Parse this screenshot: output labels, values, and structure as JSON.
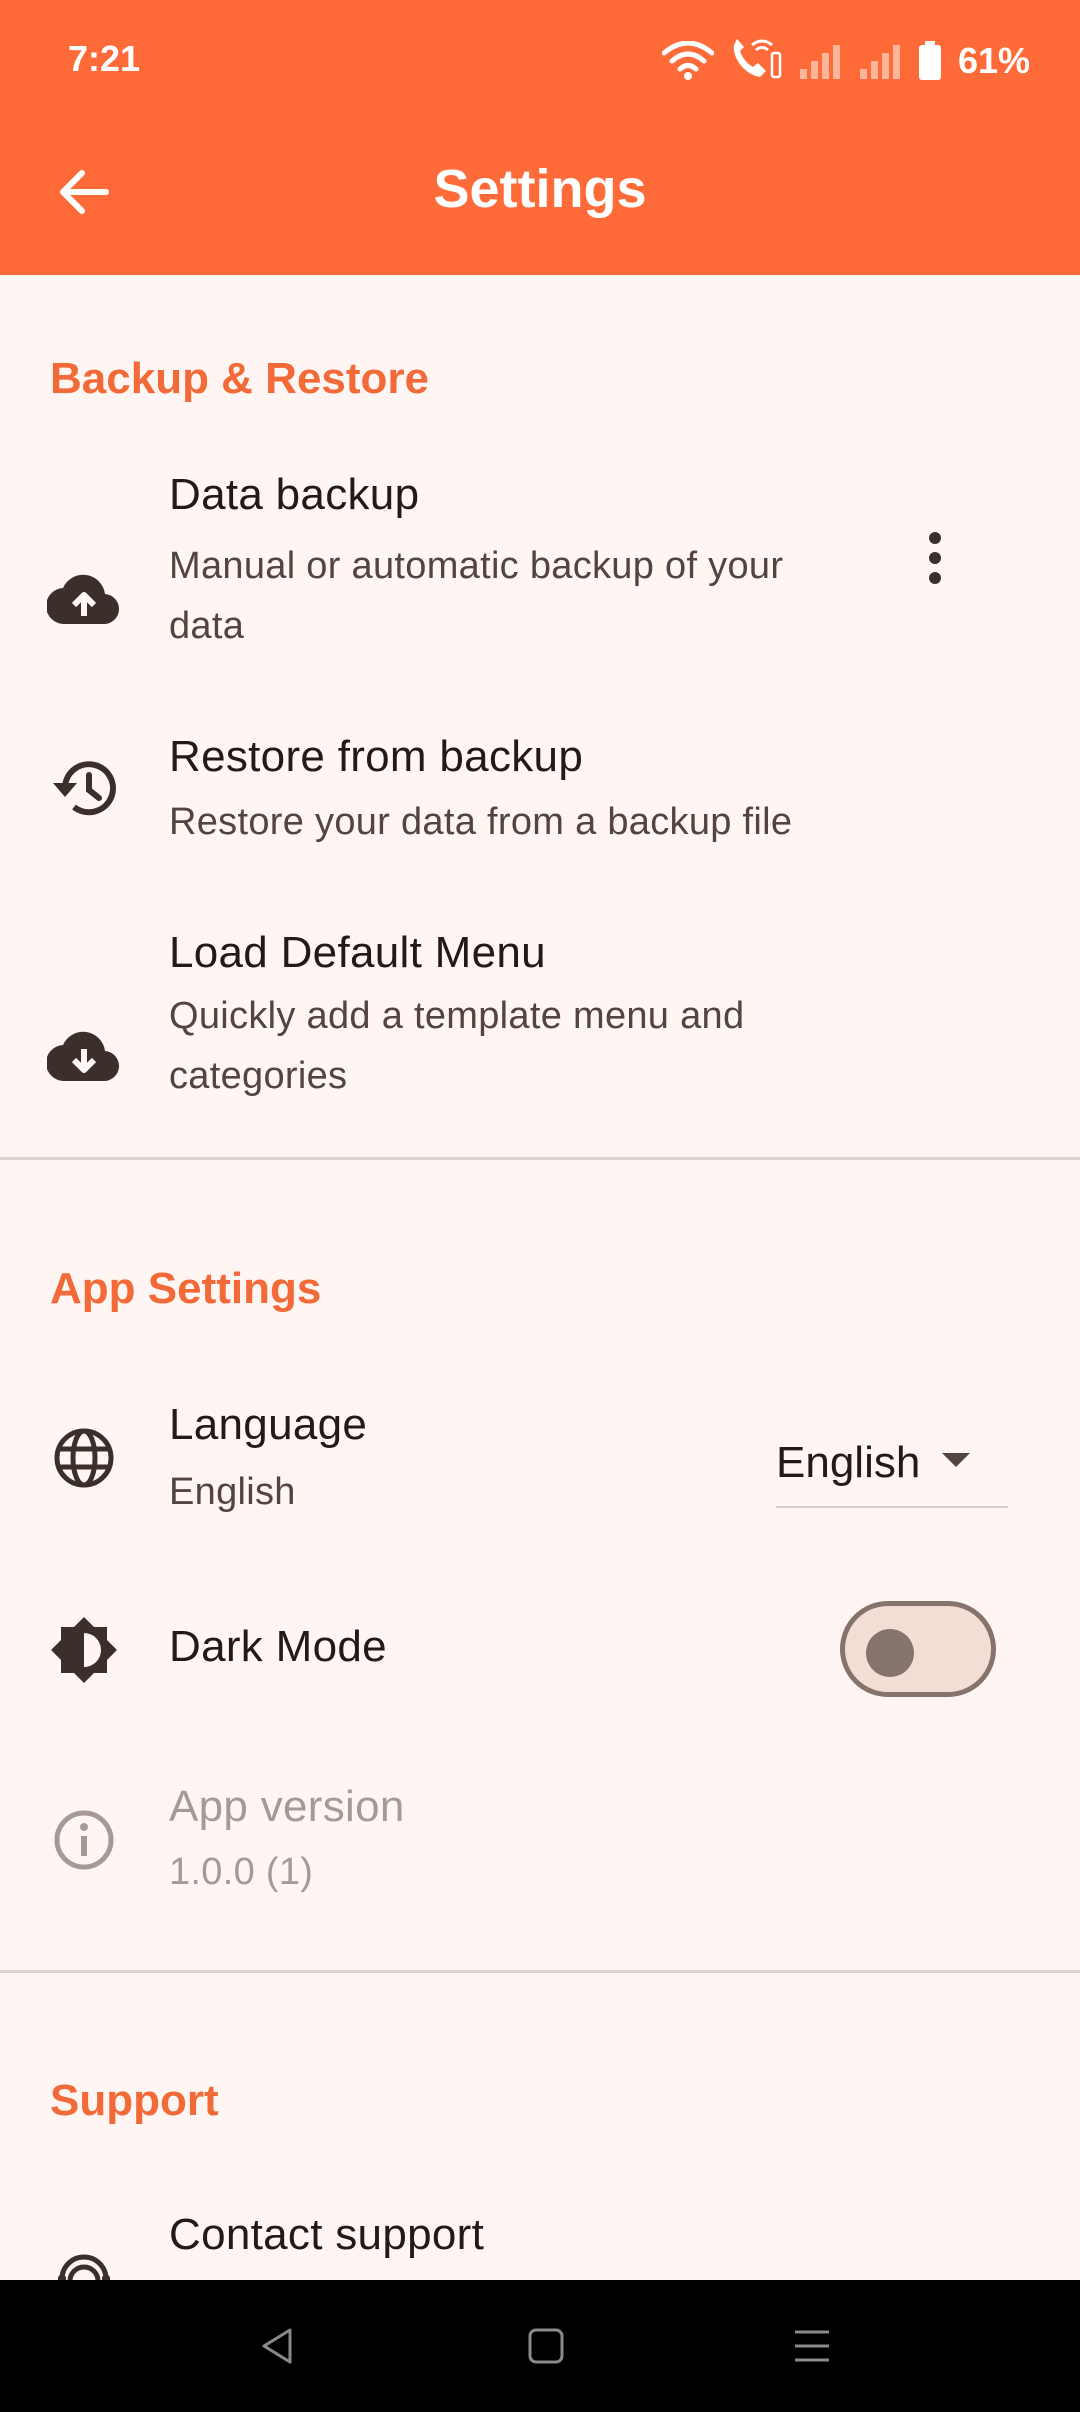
{
  "status_bar": {
    "time": "7:21",
    "battery_percent": "61%",
    "icons": [
      "wifi-icon",
      "wifi-calling-icon",
      "signal-icon",
      "signal-icon",
      "battery-icon"
    ]
  },
  "header": {
    "title": "Settings",
    "back_icon": "arrow-left-icon",
    "background": "#FF6B38"
  },
  "sections": {
    "backup": {
      "title": "Backup & Restore",
      "items": [
        {
          "icon": "cloud-upload-icon",
          "title": "Data backup",
          "subtitle": "Manual or automatic backup of your data",
          "action_icon": "more-vert-icon"
        },
        {
          "icon": "restore-history-icon",
          "title": "Restore from backup",
          "subtitle": "Restore your data from a backup file"
        },
        {
          "icon": "cloud-download-icon",
          "title": "Load Default Menu",
          "subtitle": "Quickly add a template menu and categories"
        }
      ]
    },
    "app": {
      "title": "App Settings",
      "language": {
        "icon": "globe-icon",
        "title": "Language",
        "subtitle": "English",
        "selected": "English"
      },
      "dark_mode": {
        "icon": "brightness-icon",
        "title": "Dark Mode",
        "enabled": false
      },
      "version": {
        "icon": "info-icon",
        "title": "App version",
        "subtitle": "1.0.0 (1)"
      }
    },
    "support": {
      "title": "Support",
      "items": [
        {
          "icon": "support-agent-icon",
          "title": "Contact support"
        }
      ]
    }
  },
  "colors": {
    "accent": "#F26A37",
    "background": "#FFF6F4",
    "text": "#201A18",
    "subtext": "#52443E"
  }
}
